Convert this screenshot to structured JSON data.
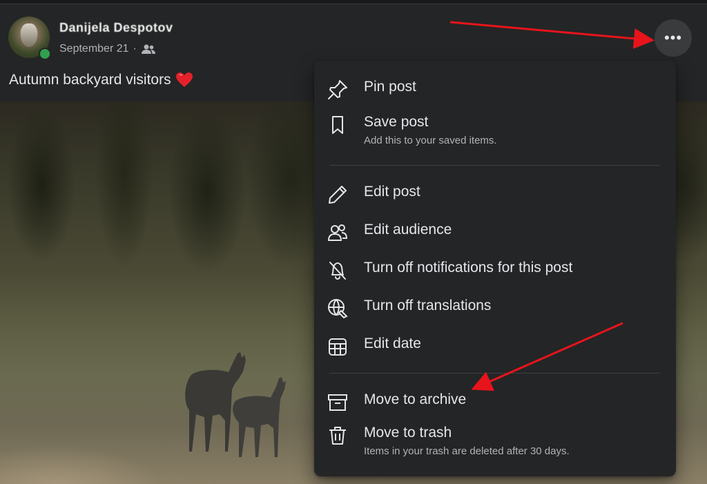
{
  "post": {
    "author_name": "Danijela Despotov",
    "date": "September 21",
    "separator": "·",
    "audience_icon": "friends-icon",
    "caption": "Autumn backyard visitors",
    "caption_emoji": "heart-icon",
    "more_button": "•••"
  },
  "menu": {
    "items": [
      {
        "label": "Pin post",
        "icon": "pin-icon"
      },
      {
        "label": "Save post",
        "description": "Add this to your saved items.",
        "icon": "bookmark-icon"
      },
      {
        "label": "Edit post",
        "icon": "pencil-icon"
      },
      {
        "label": "Edit audience",
        "icon": "people-icon"
      },
      {
        "label": "Turn off notifications for this post",
        "icon": "bell-off-icon"
      },
      {
        "label": "Turn off translations",
        "icon": "globe-translate-icon"
      },
      {
        "label": "Edit date",
        "icon": "calendar-icon"
      },
      {
        "label": "Move to archive",
        "icon": "archive-icon"
      },
      {
        "label": "Move to trash",
        "description": "Items in your trash are deleted after 30 days.",
        "icon": "trash-icon"
      }
    ]
  },
  "colors": {
    "background": "#18191a",
    "card": "#242526",
    "text_primary": "#e4e6eb",
    "text_secondary": "#b0b3b8",
    "online": "#31a24c",
    "annotation_arrow": "#e8141b"
  }
}
